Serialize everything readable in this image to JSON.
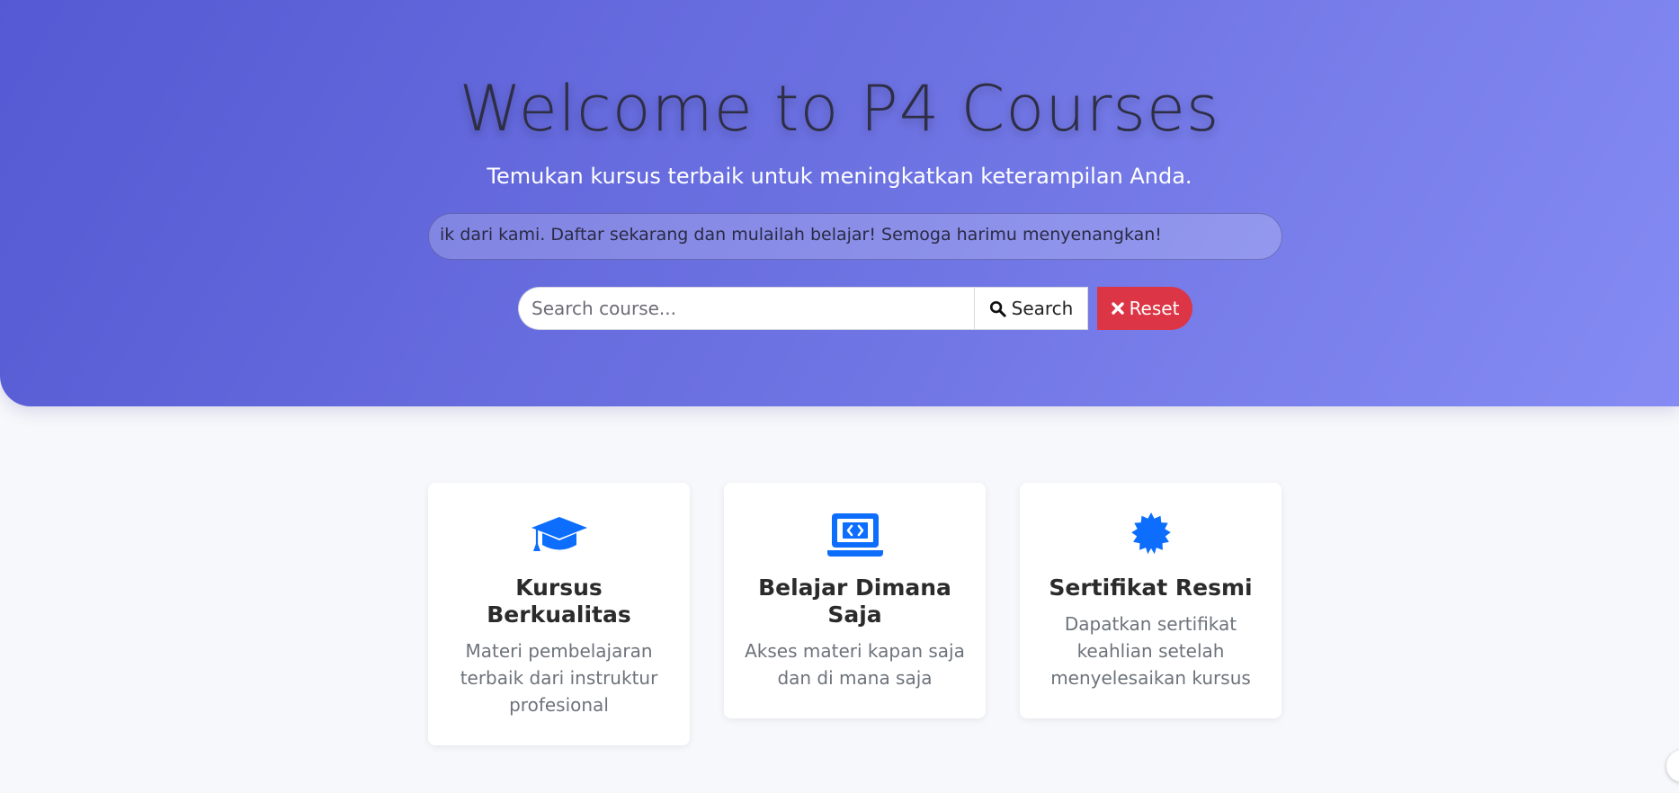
{
  "hero": {
    "title": "Welcome to P4 Courses",
    "subtitle": "Temukan kursus terbaik untuk meningkatkan keterampilan Anda.",
    "marquee": "ik dari kami. Daftar sekarang dan mulailah belajar! Semoga harimu menyenangkan!"
  },
  "search": {
    "placeholder": "Search course...",
    "value": "",
    "search_label": "Search",
    "reset_label": "Reset",
    "search_icon": "search-icon",
    "reset_icon": "close-icon"
  },
  "features": [
    {
      "icon": "graduation-cap-icon",
      "title": "Kursus Berkualitas",
      "description": "Materi pembelajaran terbaik dari instruktur profesional"
    },
    {
      "icon": "laptop-code-icon",
      "title": "Belajar Dimana Saja",
      "description": "Akses materi kapan saja dan di mana saja"
    },
    {
      "icon": "certificate-icon",
      "title": "Sertifikat Resmi",
      "description": "Dapatkan sertifikat keahlian setelah menyelesaikan kursus"
    }
  ],
  "colors": {
    "hero_gradient_start": "#5559d3",
    "hero_gradient_end": "#858bf3",
    "accent_blue": "#0d6efd",
    "reset_red": "#dc3545",
    "page_background": "#f7f8fb"
  }
}
